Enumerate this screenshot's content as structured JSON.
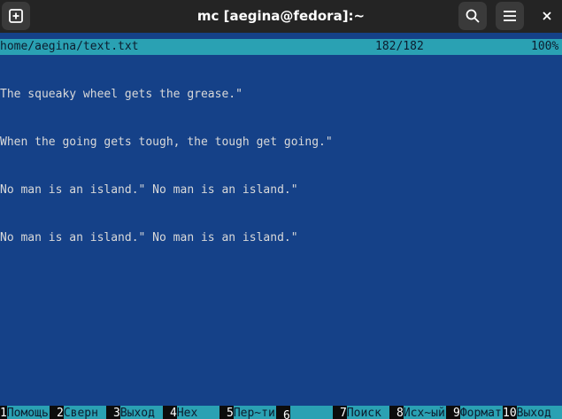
{
  "window": {
    "title": "mc [aegina@fedora]:~",
    "new_tab_icon": "plus-box-icon",
    "search_icon": "search-icon",
    "menu_icon": "hamburger-menu-icon",
    "close_icon": "close-icon"
  },
  "status": {
    "file_path": "home/aegina/text.txt",
    "position": "182/182",
    "percent": "100%"
  },
  "editor": {
    "lines": [
      "The squeaky wheel gets the grease.\"",
      "When the going gets tough, the tough get going.\"",
      "No man is an island.\" No man is an island.\"",
      "No man is an island.\" No man is an island.\""
    ]
  },
  "fkeys": [
    {
      "num": "1",
      "label": "Помощь"
    },
    {
      "num": "2",
      "label": "Сверн"
    },
    {
      "num": "3",
      "label": "Выход"
    },
    {
      "num": "4",
      "label": "Hex"
    },
    {
      "num": "5",
      "label": "Пер~ти"
    },
    {
      "num": "6",
      "label": ""
    },
    {
      "num": "7",
      "label": "Поиск"
    },
    {
      "num": "8",
      "label": "Исх~ый"
    },
    {
      "num": "9",
      "label": "Формат"
    },
    {
      "num": "10",
      "label": "Выход"
    }
  ],
  "colors": {
    "background": "#154188",
    "bar": "#2aa1b3",
    "titlebar": "#242424"
  }
}
